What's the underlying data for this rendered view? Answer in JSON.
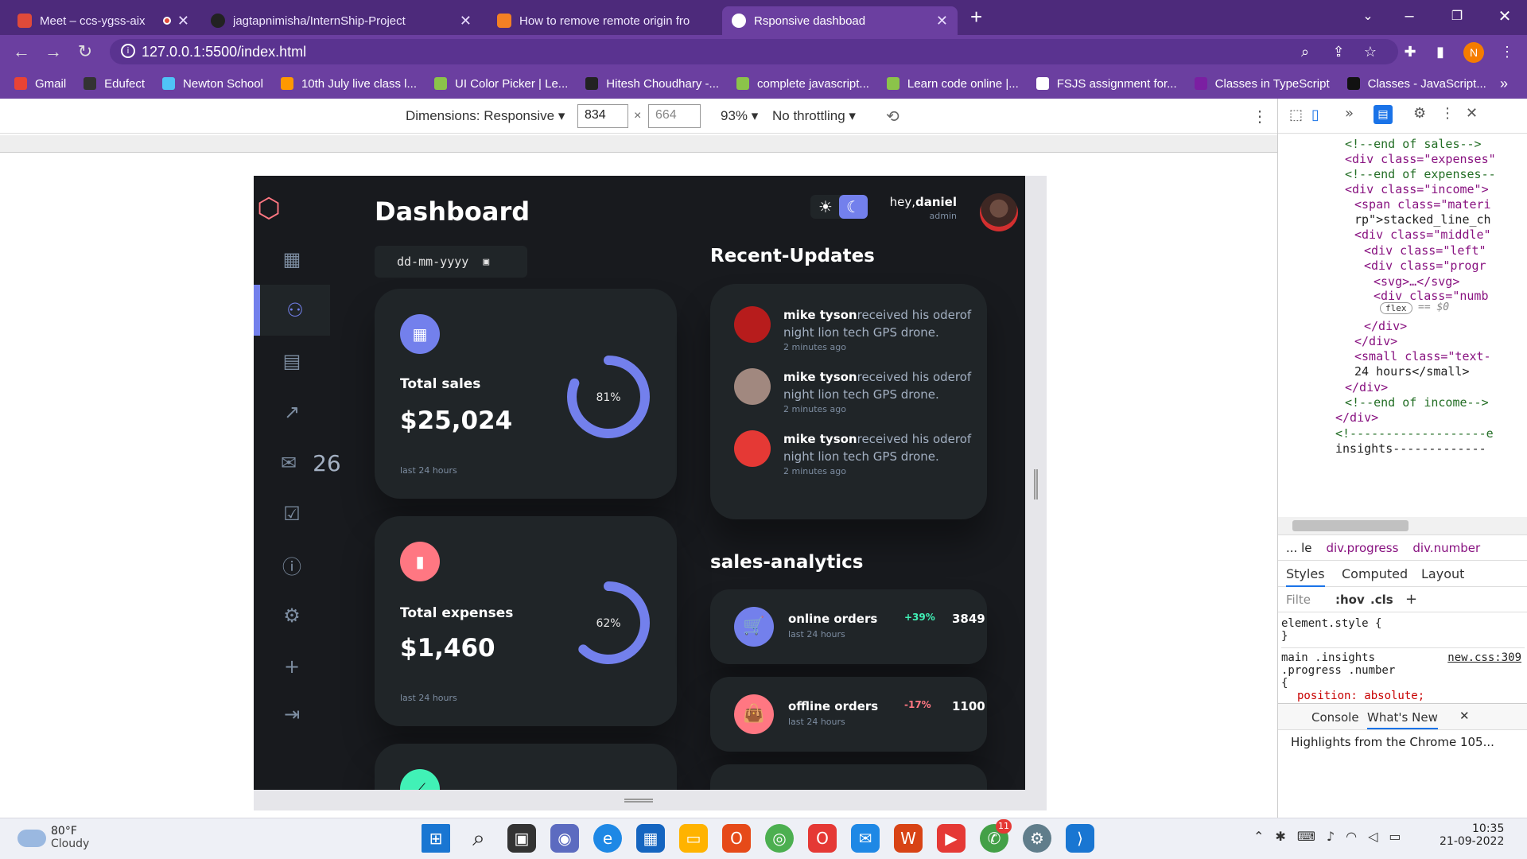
{
  "browser": {
    "tabs": [
      {
        "title": "Meet – ccs-ygss-aix",
        "color": "#e04a3a"
      },
      {
        "title": "jagtapnimisha/InternShip-Project",
        "color": "#222222"
      },
      {
        "title": "How to remove remote origin fro",
        "color": "#f48024"
      },
      {
        "title": "Rsponsive dashboad",
        "color": "#ffffff"
      }
    ],
    "url": "127.0.0.1:5500/index.html",
    "profile_initial": "N",
    "bookmarks": [
      {
        "label": "Gmail",
        "color": "#ea4335"
      },
      {
        "label": "Edufect",
        "color": "#333333"
      },
      {
        "label": "Newton School",
        "color": "#4fc3f7"
      },
      {
        "label": "10th July live class l...",
        "color": "#ff9800"
      },
      {
        "label": "UI Color Picker | Le...",
        "color": "#8bc34a"
      },
      {
        "label": "Hitesh Choudhary -...",
        "color": "#222222"
      },
      {
        "label": "complete javascript...",
        "color": "#8bc34a"
      },
      {
        "label": "Learn code online |...",
        "color": "#8bc34a"
      },
      {
        "label": "FSJS assignment for...",
        "color": "#ffffff"
      },
      {
        "label": "Classes in TypeScript",
        "color": "#7b1fa2"
      },
      {
        "label": "Classes - JavaScript...",
        "color": "#111111"
      }
    ]
  },
  "device_toolbar": {
    "dimensions_label": "Dimensions: Responsive",
    "width": "834",
    "height_placeholder": "664",
    "zoom": "93%",
    "throttle": "No throttling"
  },
  "dashboard": {
    "title": "Dashboard",
    "date_placeholder": "dd-mm-yyyy",
    "greeting_prefix": "hey,",
    "user_name": "daniel",
    "user_role": "admin",
    "message_count": "26",
    "insights": [
      {
        "title": "Total sales",
        "amount": "$25,024",
        "percent": "81%",
        "percent_value": 0.81,
        "note": "last 24 hours",
        "icon_color": "#7380ec"
      },
      {
        "title": "Total expenses",
        "amount": "$1,460",
        "percent": "62%",
        "percent_value": 0.62,
        "note": "last 24 hours",
        "icon_color": "#ff7782"
      }
    ],
    "updates_title": "Recent-Updates",
    "updates": [
      {
        "name": "mike tyson",
        "text": "received his oderof night lion tech GPS drone.",
        "time": "2 minutes ago",
        "avatar_color": "#b71c1c"
      },
      {
        "name": "mike tyson",
        "text": "received his oderof night lion tech GPS drone.",
        "time": "2 minutes ago",
        "avatar_color": "#a1887f"
      },
      {
        "name": "mike tyson",
        "text": "received his oderof night lion tech GPS drone.",
        "time": "2 minutes ago",
        "avatar_color": "#e53935"
      }
    ],
    "analytics_title": "sales-analytics",
    "analytics": [
      {
        "label": "online orders",
        "note": "last 24 hours",
        "change": "+39%",
        "count": "3849",
        "icon_color": "#7380ec",
        "change_color": "#41f1b6"
      },
      {
        "label": "offline orders",
        "note": "last 24 hours",
        "change": "-17%",
        "count": "1100",
        "icon_color": "#ff7782",
        "change_color": "#ff7782"
      }
    ]
  },
  "devtools": {
    "elements": [
      "<!--end of sales-->",
      "<div class=\"expenses\"",
      "<!--end of expenses--",
      "<div class=\"income\">",
      "<span class=\"materi",
      "rp\">stacked_line_ch",
      "<div class=\"middle\"",
      "<div class=\"left\"",
      "<div class=\"progr",
      "<svg>…</svg>",
      "<div class=\"numb",
      "</div>",
      "</div>",
      "<small class=\"text-",
      "24 hours</small>",
      "</div>",
      "<!--end of income-->",
      "</div>",
      "<!-------------------e",
      "insights-------------"
    ],
    "flex_badge": "flex",
    "selected_marker": "== $0",
    "breadcrumb": [
      "... le",
      "div.progress",
      "div.number"
    ],
    "tabs": [
      "Styles",
      "Computed",
      "Layout"
    ],
    "filter_placeholder": "Filte",
    "hov": ":hov",
    "cls": ".cls",
    "style_rules": [
      "element.style {",
      "}",
      "main .insights",
      ".progress .number",
      "{",
      "position: absolute;"
    ],
    "css_file": "new.css:309",
    "drawer_tabs": [
      "Console",
      "What's New"
    ],
    "drawer_text": "Highlights from the Chrome 105..."
  },
  "taskbar": {
    "temperature": "80°F",
    "weather": "Cloudy",
    "time": "10:35",
    "date": "21-09-2022",
    "badge": "11"
  }
}
